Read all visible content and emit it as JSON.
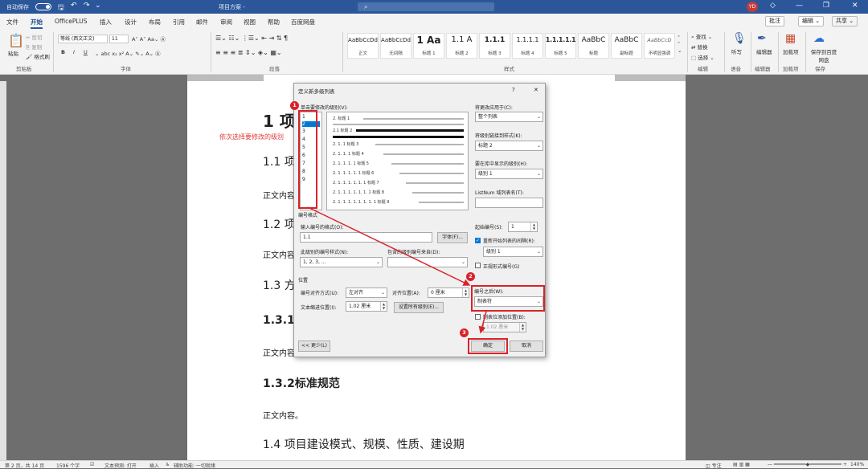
{
  "window": {
    "autosave_label": "自动保存",
    "doc_title": "项目方案 -",
    "search_placeholder": "",
    "avatar": "YD",
    "minimize": "—",
    "restore": "❐",
    "close": "✕"
  },
  "tabs": [
    "文件",
    "开始",
    "OfficePLUS",
    "插入",
    "设计",
    "布局",
    "引用",
    "邮件",
    "审阅",
    "视图",
    "帮助",
    "百度网盘"
  ],
  "tab_actions": {
    "comments": "批注",
    "editing": "编辑",
    "share": "共享"
  },
  "ribbon": {
    "clipboard": {
      "paste": "粘贴",
      "cut": "剪切",
      "copy": "复制",
      "format_painter": "格式刷",
      "group": "剪贴板"
    },
    "font": {
      "name": "等线 (西文正文)",
      "size": "11",
      "group": "字体",
      "bold": "B",
      "italic": "I",
      "underline": "U"
    },
    "paragraph": {
      "group": "段落"
    },
    "styles": {
      "group": "样式",
      "items": [
        {
          "preview": "AaBbCcDd",
          "name": "正文"
        },
        {
          "preview": "AaBbCcDd",
          "name": "无间隔"
        },
        {
          "preview": "1 Aa",
          "name": "标题 1"
        },
        {
          "preview": "1.1  A",
          "name": "标题 2"
        },
        {
          "preview": "1.1.1",
          "name": "标题 3"
        },
        {
          "preview": "1.1.1.1",
          "name": "标题 4"
        },
        {
          "preview": "1.1.1.1.1",
          "name": "标题 5"
        },
        {
          "preview": "AaBbC",
          "name": "标题"
        },
        {
          "preview": "AaBbC",
          "name": "副标题"
        },
        {
          "preview": "AaBbCcD",
          "name": "不明显强调"
        }
      ]
    },
    "editing": {
      "find": "查找",
      "replace": "替换",
      "select": "选择",
      "group": "编辑"
    },
    "voice": {
      "dictate": "听写",
      "group": "语音"
    },
    "editor": {
      "label": "编辑器",
      "group": "编辑器"
    },
    "addins": {
      "label": "加载项",
      "group": "加载项"
    },
    "save": {
      "label": "保存到百度网盘",
      "group": "保存"
    }
  },
  "document": {
    "red_note": "依次选择要修改的级别",
    "lines": [
      {
        "text": "1  项",
        "cls": "h1"
      },
      {
        "text": "1.1  项",
        "cls": "h2"
      },
      {
        "text": "正文内容",
        "cls": "body"
      },
      {
        "text": "1.2  项",
        "cls": "h2"
      },
      {
        "text": "正文内容",
        "cls": "body"
      },
      {
        "text": "1.3  方",
        "cls": "h2"
      },
      {
        "text": "1.3.1",
        "cls": "h3"
      },
      {
        "text": "正文内容",
        "cls": "body"
      },
      {
        "text": "1.3.2标准规范",
        "cls": "h3"
      },
      {
        "text": "正文内容。",
        "cls": "body"
      },
      {
        "text": "1.4  项目建设模式、规模、性质、建设期",
        "cls": "h2"
      }
    ]
  },
  "dialog": {
    "title": "定义新多级列表",
    "help": "?",
    "close": "✕",
    "level_label": "单击要修改的级别(V):",
    "levels": [
      "1",
      "2",
      "3",
      "4",
      "5",
      "6",
      "7",
      "8",
      "9"
    ],
    "preview": [
      {
        "num": "2.",
        "tail": "标题 1"
      },
      {
        "num": "2.1",
        "tail": "标题 2"
      },
      {
        "num": "2. 1. 1",
        "tail": "标题 3"
      },
      {
        "num": "2. 1. 1. 1",
        "tail": "标题 4"
      },
      {
        "num": "2. 1. 1. 1. 1",
        "tail": "标题 5"
      },
      {
        "num": "2. 1. 1. 1. 1. 1",
        "tail": "标题 6"
      },
      {
        "num": "2. 1. 1. 1. 1. 1. 1",
        "tail": "标题 7"
      },
      {
        "num": "2. 1. 1. 1. 1. 1. 1. 1",
        "tail": "标题 8"
      },
      {
        "num": "2. 1. 1. 1. 1. 1. 1. 1. 1",
        "tail": "标题 9"
      }
    ],
    "apply_to_label": "将更改应用于(C):",
    "apply_to_value": "整个列表",
    "link_style_label": "将级别链接到样式(K):",
    "link_style_value": "标题 2",
    "gallery_level_label": "要在库中显示的级别(H):",
    "gallery_level_value": "级别 1",
    "listnum_label": "ListNum 域列表名(T):",
    "listnum_value": "",
    "number_format_section": "编号格式",
    "format_label": "输入编号的格式(O):",
    "format_value": "1.1",
    "font_button": "字体(F)...",
    "style_label": "此级别的编号样式(N):",
    "style_value": "1, 2, 3, ...",
    "include_label": "包含的级别编号来自(D):",
    "include_value": "",
    "start_label": "起始编号(S):",
    "start_value": "1",
    "restart_label": "重新开始列表的间隔(R):",
    "restart_value": "级别 1",
    "legal_label": "正规形式编号(G)",
    "position_section": "位置",
    "align_label": "编号对齐方式(U):",
    "align_value": "左对齐",
    "align_at_label": "对齐位置(A):",
    "align_at_value": "0 厘米",
    "indent_label": "文本缩进位置(I):",
    "indent_value": "1.02 厘米",
    "set_all_button": "设置所有级别(E)...",
    "follow_label": "编号之后(W):",
    "follow_value": "制表符",
    "tab_stop_label": "制表位添加位置(B):",
    "tab_stop_value": "1.02 厘米",
    "less_button": "<< 更少(L)",
    "ok_button": "确定",
    "cancel_button": "取消"
  },
  "annotations": [
    "1",
    "2",
    "3"
  ],
  "status": {
    "page": "第 2 页，共 14 页",
    "words": "1596 个字",
    "predict": "文本预测: 打开",
    "insert": "插入",
    "accessibility": "辅助功能: 一切就绪",
    "focus": "专注",
    "zoom": "140%"
  },
  "colors": {
    "brand": "#2b579a",
    "annotation": "#d9222a",
    "note": "#e03b3b"
  }
}
